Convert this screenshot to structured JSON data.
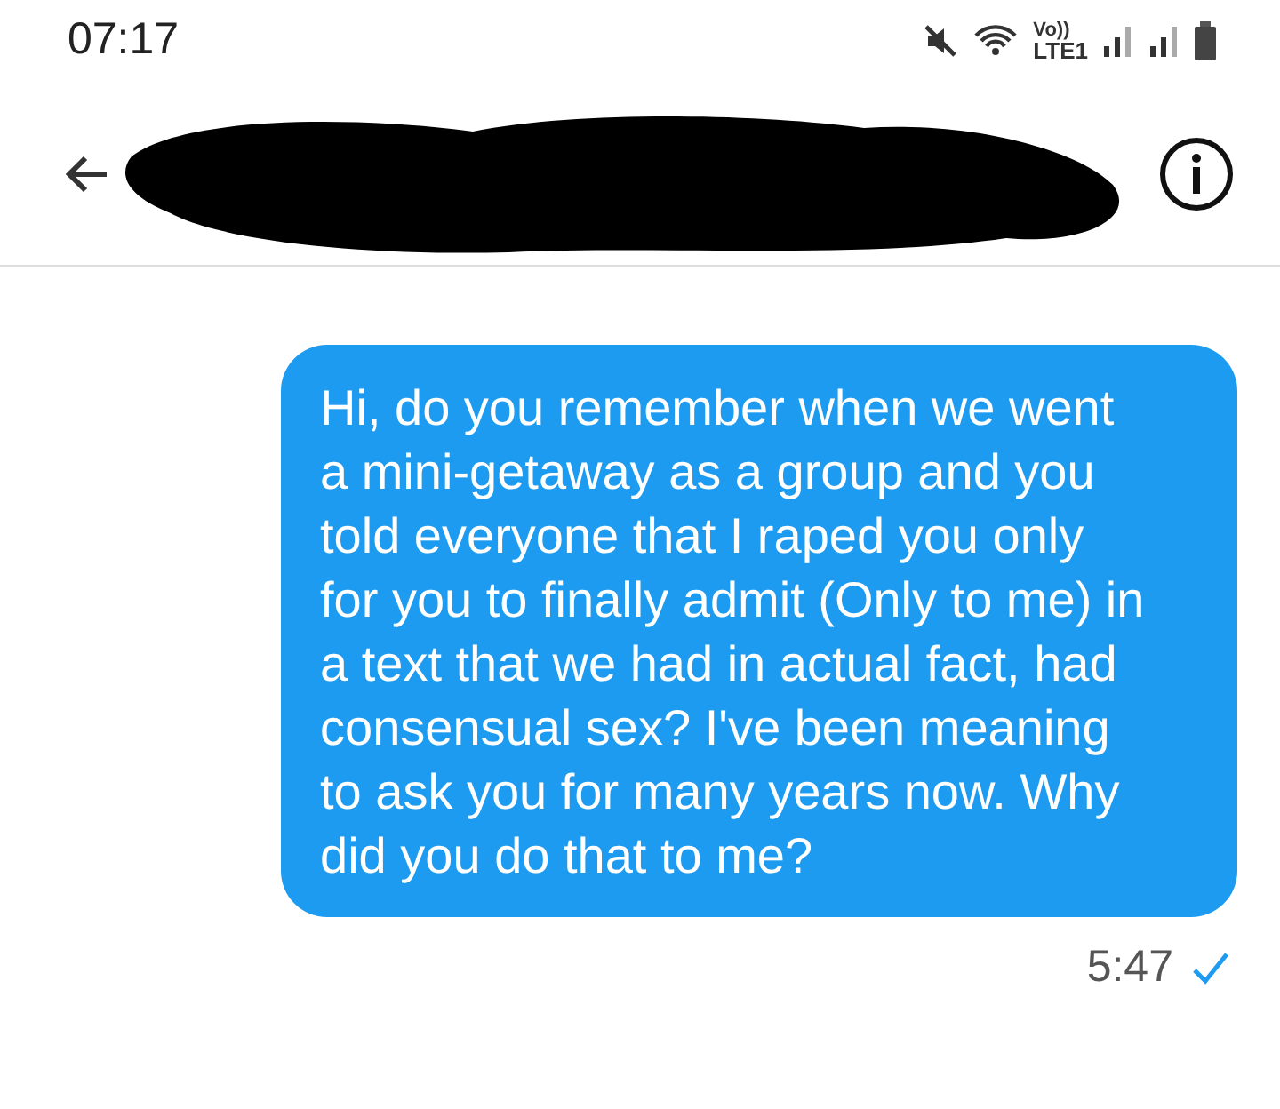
{
  "status_bar": {
    "time": "07:17",
    "network_top": "Vo))",
    "network_bottom": "LTE1"
  },
  "header": {
    "redacted": true
  },
  "messages": [
    {
      "text": "Hi, do you remember when we went a mini-getaway as a group and you told everyone that I raped you only for you to finally admit (Only to me) in a text that we had in actual fact, had consensual sex? I've been meaning to ask you for many years now. Why did you do that to me?",
      "time": "5:47",
      "delivered": true
    }
  ]
}
